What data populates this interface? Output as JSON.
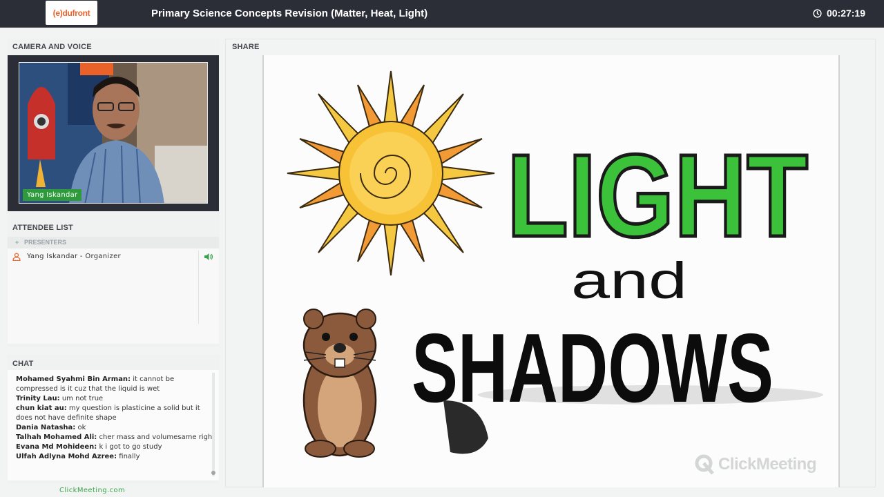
{
  "header": {
    "logo_text": "(e)dufront",
    "title": "Primary Science Concepts Revision (Matter, Heat, Light)",
    "timer": "00:27:19"
  },
  "camera": {
    "label": "CAMERA AND VOICE",
    "presenter_name": "Yang Iskandar"
  },
  "attendees": {
    "label": "ATTENDEE LIST",
    "group": "PRESENTERS",
    "items": [
      {
        "name": "Yang Iskandar - Organizer"
      }
    ]
  },
  "chat": {
    "label": "CHAT",
    "messages": [
      {
        "user": "Mohamed Syahmi Bin Arman:",
        "text": "it cannot be compressed is it cuz that the liquid is wet"
      },
      {
        "user": "Trinity Lau:",
        "text": "um not true"
      },
      {
        "user": "chun kiat au:",
        "text": "my question is plasticine a solid but it does not have definite shape"
      },
      {
        "user": "Dania Natasha:",
        "text": "ok"
      },
      {
        "user": "Talhah Mohamed Ali:",
        "text": "cher mass and volumesame right"
      },
      {
        "user": "Evana Md Mohideen:",
        "text": "k i got to go study"
      },
      {
        "user": "Ulfah Adlyna Mohd Azree:",
        "text": "finally"
      }
    ]
  },
  "share": {
    "label": "SHARE",
    "slide": {
      "word1": "LIGHT",
      "word2": "and",
      "word3": "SHADOWS"
    },
    "watermark": "ClickMeeting"
  },
  "footer": {
    "link": "ClickMeeting.com"
  },
  "colors": {
    "topbar": "#2b2e37",
    "accent_green": "#2e9a3c",
    "light_green": "#3fc23a"
  }
}
